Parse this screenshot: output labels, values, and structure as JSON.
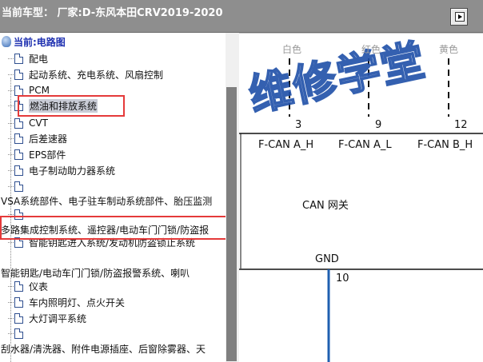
{
  "title_bar": {
    "title": "当前车型： 厂家:D-东风本田CRV2019-2020",
    "collapse_icon": "collapse-pane-icon"
  },
  "tree": {
    "root_label": "当前:电路图",
    "root_icon": "diagram-root-icon",
    "items": [
      {
        "label": "配电"
      },
      {
        "label": "起动系统、充电系统、风扇控制"
      },
      {
        "label": "PCM"
      },
      {
        "label": "燃油和排放系统"
      },
      {
        "label": "CVT"
      },
      {
        "label": "后差速器"
      },
      {
        "label": "EPS部件"
      },
      {
        "label": "电子制动助力器系统"
      },
      {
        "label": ""
      },
      {
        "label": "VSA系统部件、电子驻车制动系统部件、胎压监测"
      },
      {
        "label": ""
      },
      {
        "label": "多路集成控制系统、遥控器/电动车门门锁/防盗报"
      },
      {
        "label": "智能钥匙进入系统/发动机防盗锁止系统"
      },
      {
        "label": "智能钥匙/电动车门门锁/防盗报警系统、喇叭"
      },
      {
        "label": "仪表"
      },
      {
        "label": "车内照明灯、点火开关"
      },
      {
        "label": "大灯调平系统"
      },
      {
        "label": ""
      },
      {
        "label": "刮水器/清洗器、附件电源插座、后窗除雾器、天"
      }
    ]
  },
  "diagram": {
    "watermark_text": "维修学堂",
    "wire_colors": [
      "白色",
      "红色",
      "黄色"
    ],
    "pins": [
      "3",
      "9",
      "12"
    ],
    "signals": [
      "F-CAN A_H",
      "F-CAN A_L",
      "F-CAN B_H"
    ],
    "module_label": "CAN 网关",
    "ground_label": "GND",
    "ground_pin": "10",
    "colors": {
      "ground_wire": "#1f5fb0",
      "highlight_box": "#e53a3a"
    }
  }
}
